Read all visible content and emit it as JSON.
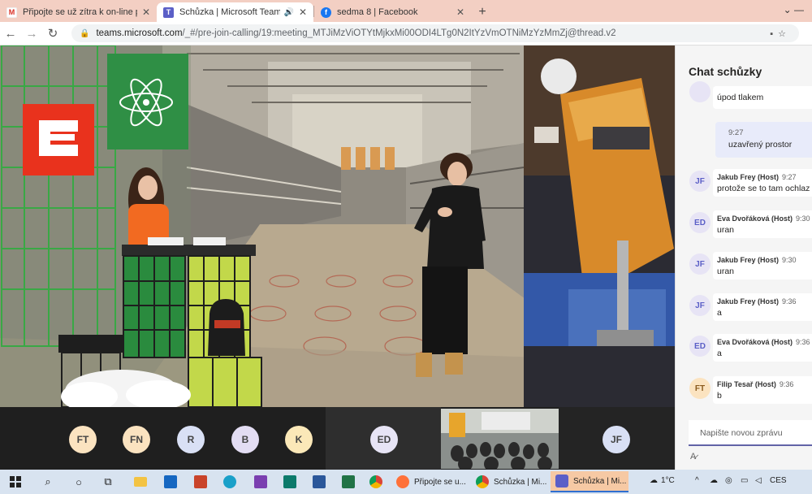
{
  "browser": {
    "tabs": [
      {
        "title": "Připojte se už zítra k on-line proh",
        "icon": "gmail-icon",
        "active": false
      },
      {
        "title": "Schůzka | Microsoft Teams",
        "icon": "teams-icon",
        "active": true
      },
      {
        "title": "sedma 8 | Facebook",
        "icon": "facebook-icon",
        "active": false
      }
    ],
    "new_tab": "+",
    "window_controls": "⌄    —",
    "url_host": "teams.microsoft.com",
    "url_path": "/_#/pre-join-calling/19:meeting_MTJiMzViOTYtMjkxMi00ODI4LTg0N2ItYzVmOTNiMzYzMmZj@thread.v2"
  },
  "chat": {
    "title": "Chat schůzky",
    "messages": [
      {
        "initials": "",
        "name": "",
        "time": "",
        "text": "úpod tlakem",
        "mine": false
      },
      {
        "initials": "",
        "name": "",
        "time": "9:27",
        "text": "uzavřený prostor",
        "mine": true
      },
      {
        "initials": "JF",
        "name": "Jakub Frey (Host)",
        "time": "9:27",
        "text": "protože se to tam ochlaz",
        "mine": false
      },
      {
        "initials": "ED",
        "name": "Eva Dvořáková (Host)",
        "time": "9:30",
        "text": "uran",
        "mine": false
      },
      {
        "initials": "JF",
        "name": "Jakub Frey (Host)",
        "time": "9:30",
        "text": "uran",
        "mine": false
      },
      {
        "initials": "JF",
        "name": "Jakub Frey (Host)",
        "time": "9:36",
        "text": "a",
        "mine": false
      },
      {
        "initials": "ED",
        "name": "Eva Dvořáková (Host)",
        "time": "9:36",
        "text": "a",
        "mine": false
      },
      {
        "initials": "FT",
        "name": "Filip Tesař (Host)",
        "time": "9:36",
        "text": "b",
        "mine": false
      }
    ],
    "compose_placeholder": "Napište novou zprávu"
  },
  "participants": [
    {
      "initials": "FT",
      "color": "#fbe3c0"
    },
    {
      "initials": "FN",
      "color": "#fbe3c0"
    },
    {
      "initials": "R",
      "color": "#d9e0f5"
    },
    {
      "initials": "B",
      "color": "#e3ddf3"
    },
    {
      "initials": "K",
      "color": "#fbe8b8"
    },
    {
      "initials": "ED",
      "color": "#e7e4f5"
    },
    {
      "initials": "JF",
      "color": "#d9e0f5"
    }
  ],
  "taskbar": {
    "apps": [
      {
        "label": "Připojte se u...",
        "icon": "firefox-icon",
        "active": false
      },
      {
        "label": "Schůzka | Mi...",
        "icon": "chrome-icon",
        "active": false
      },
      {
        "label": "Schůzka | Mi...",
        "icon": "teams-icon",
        "active": true
      }
    ],
    "temperature": "1°C",
    "language": "CES"
  }
}
